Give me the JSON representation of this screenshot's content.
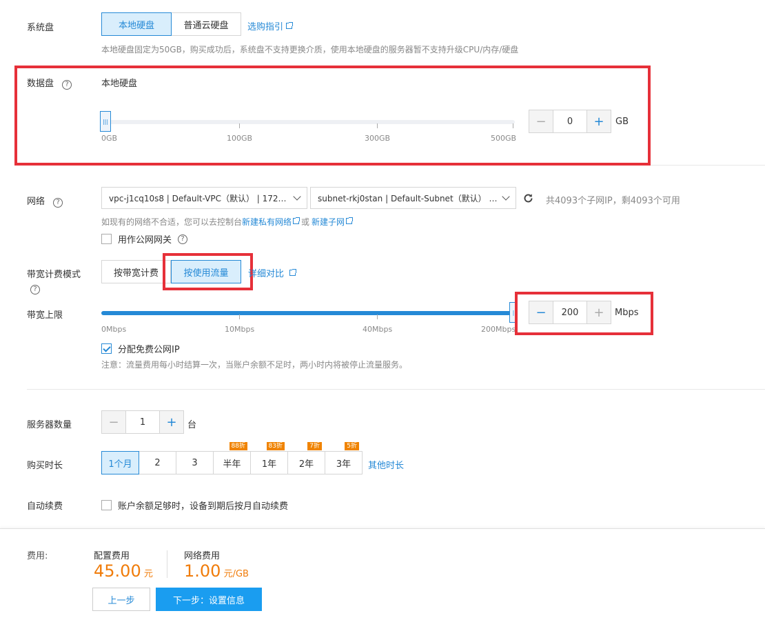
{
  "system_disk": {
    "label": "系统盘",
    "options": [
      "本地硬盘",
      "普通云硬盘"
    ],
    "guide_link": "选购指引",
    "hint": "本地硬盘固定为50GB，购买成功后，系统盘不支持更换介质，使用本地硬盘的服务器暂不支持升级CPU/内存/硬盘"
  },
  "data_disk": {
    "label": "数据盘",
    "type": "本地硬盘",
    "ticks": [
      "0GB",
      "100GB",
      "300GB",
      "500GB"
    ],
    "value": "0",
    "unit": "GB"
  },
  "network": {
    "label": "网络",
    "vpc": "vpc-j1cq10s8 | Default-VPC（默认） | 172…",
    "subnet": "subnet-rkj0stan | Default-Subnet（默认） …",
    "ip_info": "共4093个子网IP，剩4093个可用",
    "hint_prefix": "如现有的网络不合适，您可以去控制台",
    "new_vpc_link": "新建私有网络",
    "or": "或",
    "new_subnet_link": "新建子网",
    "gateway_label": "用作公网网关"
  },
  "bandwidth_mode": {
    "label": "带宽计费模式",
    "options": [
      "按带宽计费",
      "按使用流量"
    ],
    "compare_link": "详细对比"
  },
  "bandwidth_limit": {
    "label": "带宽上限",
    "ticks": [
      "0Mbps",
      "10Mbps",
      "40Mbps",
      "200Mbps"
    ],
    "value": "200",
    "unit": "Mbps",
    "free_ip_label": "分配免费公网IP",
    "note": "注意：流量费用每小时结算一次，当账户余额不足时，两小时内将被停止流量服务。"
  },
  "server_count": {
    "label": "服务器数量",
    "value": "1",
    "unit": "台"
  },
  "purchase_duration": {
    "label": "购买时长",
    "options": [
      {
        "label": "1个月",
        "badge": ""
      },
      {
        "label": "2",
        "badge": ""
      },
      {
        "label": "3",
        "badge": ""
      },
      {
        "label": "半年",
        "badge": "88折"
      },
      {
        "label": "1年",
        "badge": "83折"
      },
      {
        "label": "2年",
        "badge": "7折"
      },
      {
        "label": "3年",
        "badge": "5折"
      }
    ],
    "other_link": "其他时长"
  },
  "auto_renew": {
    "label": "自动续费",
    "text": "账户余额足够时，设备到期后按月自动续费"
  },
  "footer": {
    "fee_label": "费用:",
    "config_fee_label": "配置费用",
    "config_fee": "45.00",
    "config_unit": "元",
    "network_fee_label": "网络费用",
    "network_fee": "1.00",
    "network_unit": "元/GB",
    "prev_button": "上一步",
    "next_button": "下一步：设置信息"
  },
  "colors": {
    "accent": "#2589d6",
    "highlight": "#e63039",
    "price": "#f07c0a"
  }
}
